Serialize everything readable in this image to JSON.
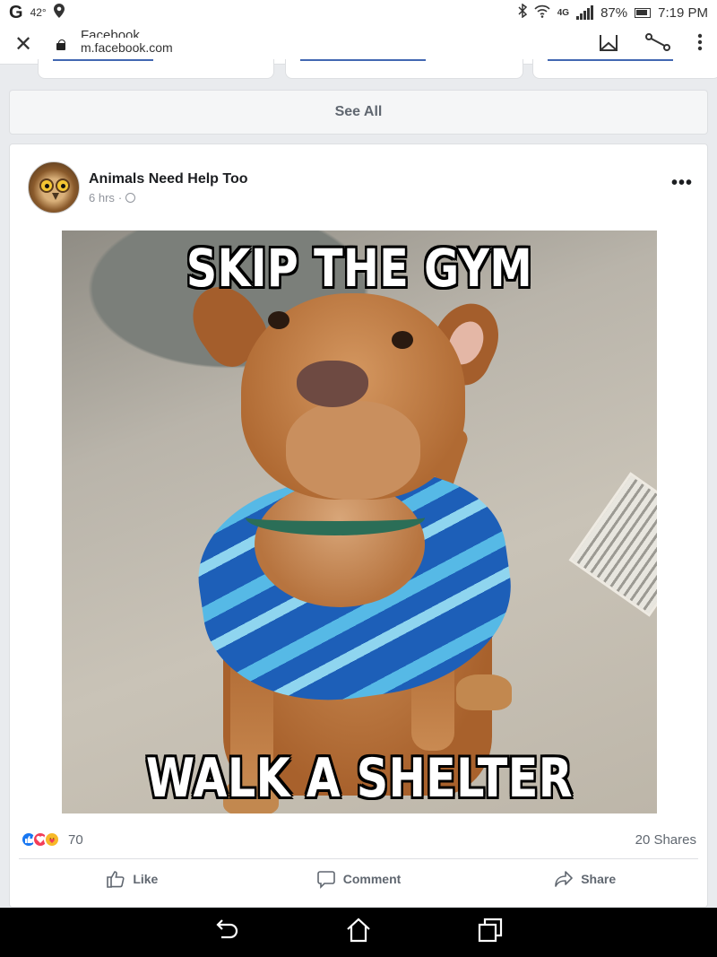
{
  "status_bar": {
    "carrier_icon": "google-g-icon",
    "temperature": "42°",
    "network": "4G",
    "battery": "87%",
    "time": "7:19 PM"
  },
  "browser": {
    "page_title": "Facebook",
    "url": "m.facebook.com"
  },
  "feed": {
    "see_all_label": "See All"
  },
  "post": {
    "page_name": "Animals Need Help Too",
    "time": "6 hrs",
    "time_separator": "·",
    "more_label": "•••",
    "image": {
      "top_caption": "SKIP THE GYM",
      "bottom_caption": "WALK A SHELTER DOG!"
    },
    "reaction_count": "70",
    "shares": "20 Shares",
    "actions": {
      "like": "Like",
      "comment": "Comment",
      "share": "Share"
    }
  },
  "colors": {
    "facebook_blue": "#4267b2",
    "like_blue": "#1877f2",
    "love_red": "#f33e58",
    "care_yellow": "#f7b928",
    "feed_background": "#e9ebee"
  }
}
